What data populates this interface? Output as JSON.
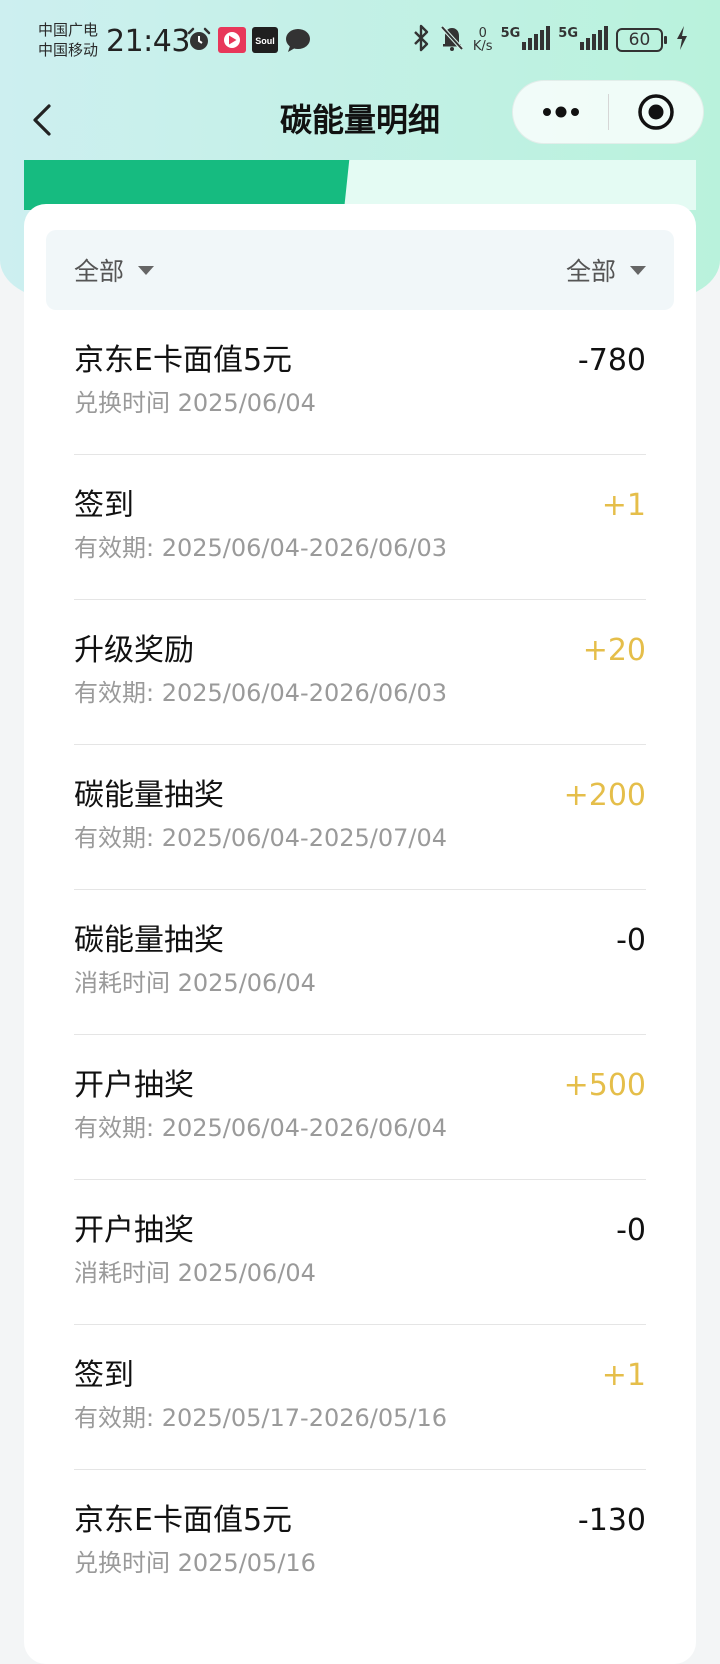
{
  "status_bar": {
    "carrier_1": "中国广电",
    "carrier_2": "中国移动",
    "time": "21:43",
    "net_speed_value": "0",
    "net_speed_unit": "K/s",
    "signal_1_label": "5G",
    "signal_2_label": "5G",
    "battery": "60",
    "icons_left": [
      "alarm-icon",
      "video-app-icon",
      "soul-app-icon",
      "chat-bubble-icon"
    ],
    "icons_right": [
      "bluetooth-icon",
      "mute-bell-icon",
      "signal-icon",
      "signal-icon",
      "battery-icon",
      "charging-icon"
    ]
  },
  "nav": {
    "title": "碳能量明细",
    "back_icon": "back-chevron-icon",
    "more_icon": "more-dots-icon",
    "close_icon": "target-close-icon"
  },
  "filters": {
    "left_label": "全部",
    "right_label": "全部"
  },
  "records": [
    {
      "title": "京东E卡面值5元",
      "sub": "兑换时间 2025/06/04",
      "amount": "-780",
      "type": "neg"
    },
    {
      "title": "签到",
      "sub": "有效期: 2025/06/04-2026/06/03",
      "amount": "+1",
      "type": "pos"
    },
    {
      "title": "升级奖励",
      "sub": "有效期: 2025/06/04-2026/06/03",
      "amount": "+20",
      "type": "pos"
    },
    {
      "title": "碳能量抽奖",
      "sub": "有效期: 2025/06/04-2025/07/04",
      "amount": "+200",
      "type": "pos"
    },
    {
      "title": "碳能量抽奖",
      "sub": "消耗时间 2025/06/04",
      "amount": "-0",
      "type": "neg"
    },
    {
      "title": "开户抽奖",
      "sub": "有效期: 2025/06/04-2026/06/04",
      "amount": "+500",
      "type": "pos"
    },
    {
      "title": "开户抽奖",
      "sub": "消耗时间 2025/06/04",
      "amount": "-0",
      "type": "neg"
    },
    {
      "title": "签到",
      "sub": "有效期: 2025/05/17-2026/05/16",
      "amount": "+1",
      "type": "pos"
    },
    {
      "title": "京东E卡面值5元",
      "sub": "兑换时间 2025/05/16",
      "amount": "-130",
      "type": "neg"
    }
  ],
  "colors": {
    "positive_amount": "#e5be4a",
    "negative_amount": "#111111",
    "banner_green": "#16bb80"
  }
}
